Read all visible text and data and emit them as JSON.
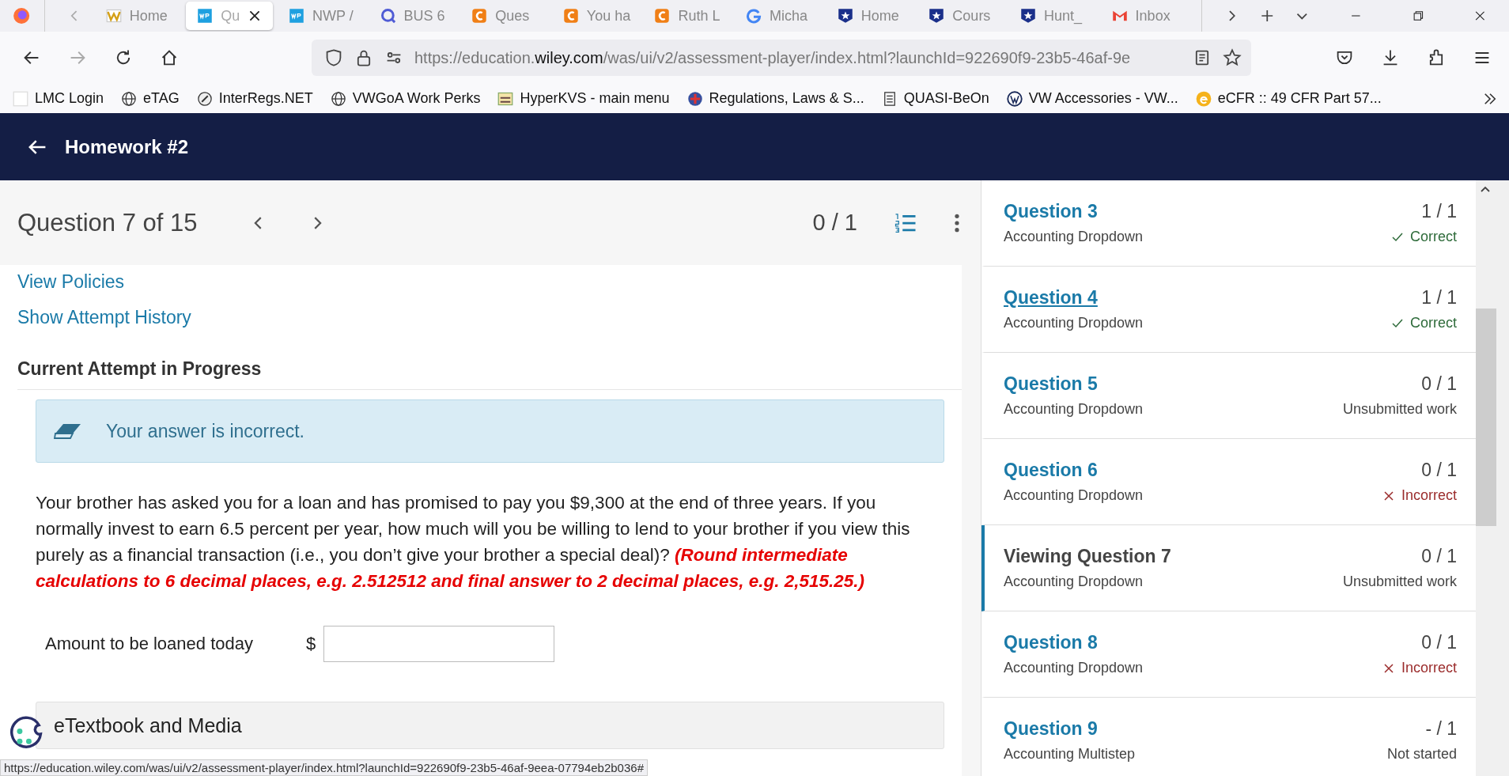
{
  "browser": {
    "tabs": [
      {
        "kind": "w",
        "label": "Home",
        "selected": false
      },
      {
        "kind": "wp",
        "label": "Qu",
        "selected": true
      },
      {
        "kind": "wp",
        "label": "NWP /",
        "selected": false
      },
      {
        "kind": "q",
        "label": "BUS 6",
        "selected": false
      },
      {
        "kind": "c",
        "label": "Ques",
        "selected": false
      },
      {
        "kind": "c",
        "label": "You ha",
        "selected": false
      },
      {
        "kind": "c",
        "label": "Ruth L",
        "selected": false
      },
      {
        "kind": "g",
        "label": "Micha",
        "selected": false
      },
      {
        "kind": "star",
        "label": "Home",
        "selected": false
      },
      {
        "kind": "star",
        "label": "Cours",
        "selected": false
      },
      {
        "kind": "star",
        "label": "Hunt_",
        "selected": false
      },
      {
        "kind": "mail",
        "label": "Inbox",
        "selected": false
      }
    ],
    "url_parts": [
      "https://education.",
      "wiley.com",
      "/was/ui/v2/assessment-player/index.html?launchId=922690f9-23b5-46af-9e"
    ],
    "bookmarks": [
      {
        "kind": "blank",
        "label": "LMC Login"
      },
      {
        "kind": "globe",
        "label": "eTAG"
      },
      {
        "kind": "ring",
        "label": "InterRegs.NET"
      },
      {
        "kind": "globe",
        "label": "VWGoA Work Perks"
      },
      {
        "kind": "kvs",
        "label": "HyperKVS - main menu"
      },
      {
        "kind": "seal",
        "label": "Regulations, Laws & S..."
      },
      {
        "kind": "page",
        "label": "QUASI-BeOn"
      },
      {
        "kind": "vw",
        "label": "VW Accessories - VW..."
      },
      {
        "kind": "e",
        "label": "eCFR :: 49 CFR Part 57..."
      }
    ]
  },
  "header": {
    "title": "Homework #2"
  },
  "question_bar": {
    "title": "Question 7 of 15",
    "score": "0 / 1"
  },
  "links": [
    "View Policies",
    "Show Attempt History"
  ],
  "attempt_heading": "Current Attempt in Progress",
  "alert": "Your answer is incorrect.",
  "question_text": "Your brother has asked you for a loan and has promised to pay you $9,300 at the end of three years. If you normally invest to earn 6.5 percent per year, how much will you be willing to lend to your brother if you view this purely as a financial transaction (i.e., you don’t give your brother a special deal)? ",
  "instruction": "(Round intermediate calculations to 6 decimal places, e.g. 2.512512 and final answer to 2 decimal places, e.g. 2,515.25.)",
  "answer": {
    "label": "Amount to be loaned today",
    "currency": "$"
  },
  "textbook_section": "eTextbook and Media",
  "status_bar": "https://education.wiley.com/was/ui/v2/assessment-player/index.html?launchId=922690f9-23b5-46af-9eea-07794eb2b036#",
  "questions": [
    {
      "title": "Question 3",
      "type": "Accounting Dropdown",
      "score": "1 / 1",
      "kind": "correct",
      "status_text": "Correct",
      "selected": false,
      "hovered": false
    },
    {
      "title": "Question 4",
      "type": "Accounting Dropdown",
      "score": "1 / 1",
      "kind": "correct",
      "status_text": "Correct",
      "selected": false,
      "hovered": true
    },
    {
      "title": "Question 5",
      "type": "Accounting Dropdown",
      "score": "0 / 1",
      "kind": "unsubmitted",
      "status_text": "Unsubmitted work",
      "selected": false,
      "hovered": false
    },
    {
      "title": "Question 6",
      "type": "Accounting Dropdown",
      "score": "0 / 1",
      "kind": "incorrect",
      "status_text": "Incorrect",
      "selected": false,
      "hovered": false
    },
    {
      "title": "Viewing Question 7",
      "type": "Accounting Dropdown",
      "score": "0 / 1",
      "kind": "unsubmitted",
      "status_text": "Unsubmitted work",
      "selected": true,
      "hovered": false
    },
    {
      "title": "Question 8",
      "type": "Accounting Dropdown",
      "score": "0 / 1",
      "kind": "incorrect",
      "status_text": "Incorrect",
      "selected": false,
      "hovered": false
    },
    {
      "title": "Question 9",
      "type": "Accounting Multistep",
      "score": "- / 1",
      "kind": "not_started",
      "status_text": "Not started",
      "selected": false,
      "hovered": false
    }
  ]
}
